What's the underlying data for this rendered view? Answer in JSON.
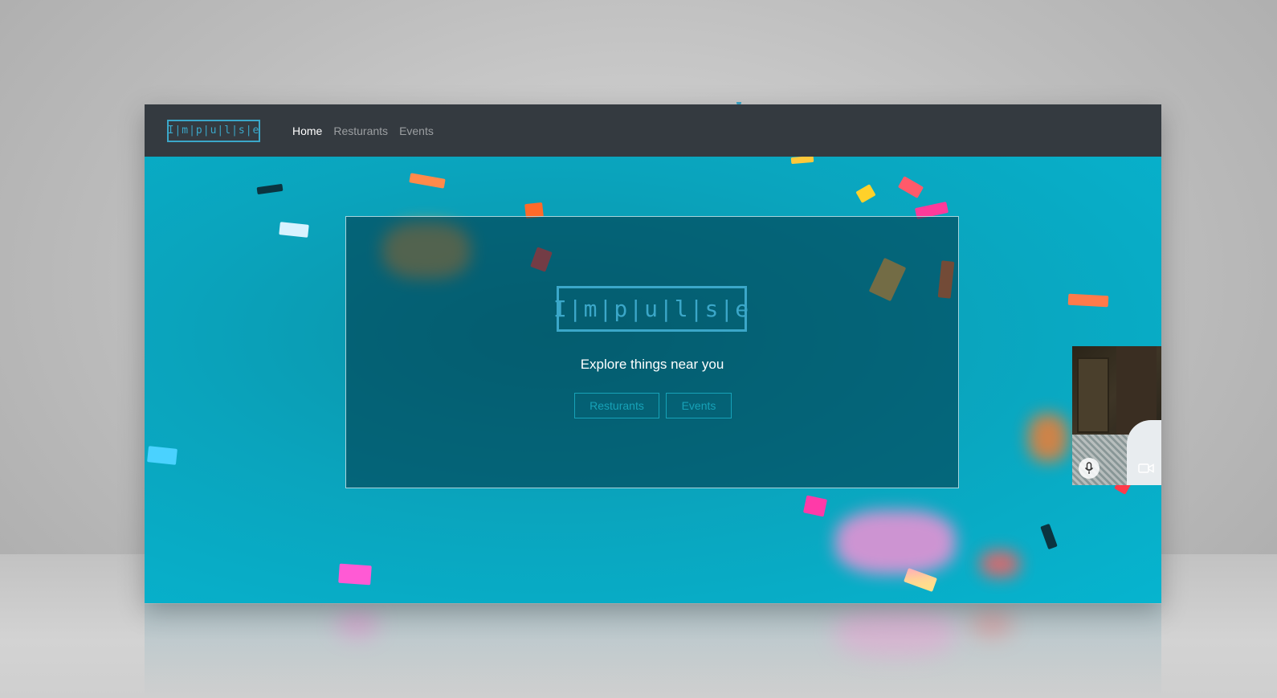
{
  "app": {
    "logo_text": "I|m|p|u|l|s|e"
  },
  "navbar": {
    "items": [
      {
        "label": "Home",
        "active": true
      },
      {
        "label": "Resturants",
        "active": false
      },
      {
        "label": "Events",
        "active": false
      }
    ]
  },
  "hero": {
    "logo_text": "I|m|p|u|l|s|e",
    "tagline": "Explore things near you",
    "buttons": {
      "restaurants_label": "Resturants",
      "events_label": "Events"
    }
  },
  "video_call": {
    "mic_icon": "microphone-icon",
    "camera_icon": "video-camera-icon"
  },
  "colors": {
    "navbar_bg": "#343a40",
    "accent": "#17a2b8",
    "logo_blue": "#3ba7c9",
    "hero_bg": "#0aa4bd"
  }
}
